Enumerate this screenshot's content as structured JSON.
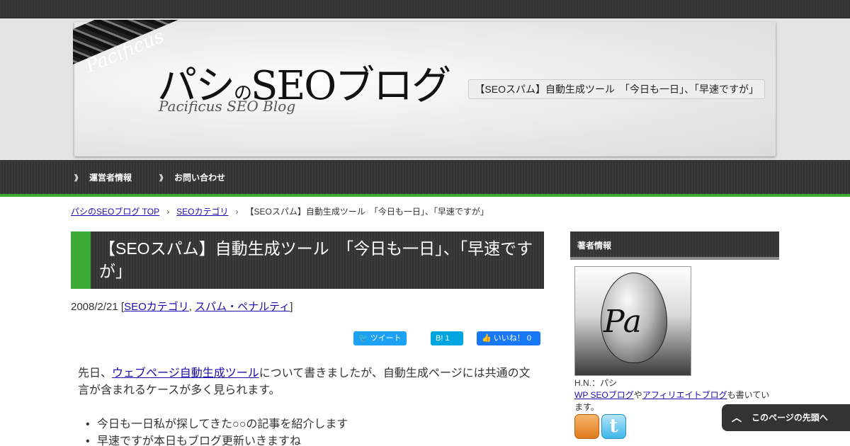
{
  "site": {
    "title_main_1": "パシ",
    "title_small": "の",
    "title_main_2": "SEOブログ",
    "subtitle": "Pacificus SEO Blog",
    "ribbon_text": "Pacificus",
    "description": "【SEOスパム】自動生成ツール　「今日も一日」、「早速ですが」"
  },
  "nav": {
    "items": [
      {
        "label": "運営者情報"
      },
      {
        "label": "お問い合わせ"
      }
    ],
    "arrow": "》"
  },
  "breadcrumb": {
    "items": [
      "パシのSEOブログ TOP",
      "SEOカテゴリ",
      "【SEOスパム】自動生成ツール　「今日も一日」、「早速ですが」"
    ],
    "separator": "›"
  },
  "post": {
    "title": "【SEOスパム】自動生成ツール　「今日も一日」、「早速ですが」",
    "date": "2008/2/21",
    "categories": [
      "SEOカテゴリ",
      "スパム・ペナルティ"
    ],
    "share": {
      "tweet": "ツイート",
      "hatena": "B! 1",
      "like": "いいね！ 0"
    },
    "body_pre": "先日、",
    "body_link": "ウェブページ自動生成ツール",
    "body_post": "について書きましたが、自動生成ページには共通の文言が含まれるケースが多く見られます。",
    "list": [
      "今日も一日私が探してきた○○の記事を紹介します",
      "早速ですが本日もブログ更新いきますね"
    ]
  },
  "sidebar": {
    "widget_title": "著者情報",
    "avatar_text": "Pa",
    "hn": "H.N.：パシ",
    "desc_link1": "WP SEOブログ",
    "desc_mid": "や",
    "desc_link2": "アフィリエイトブログ",
    "desc_post": "も書いています。"
  },
  "to_top": {
    "label": "このページの先頭へ",
    "icon": "︿"
  },
  "colors": {
    "accent_green": "#3bac33",
    "dark_bar": "#333333",
    "link": "#1a0dab"
  }
}
